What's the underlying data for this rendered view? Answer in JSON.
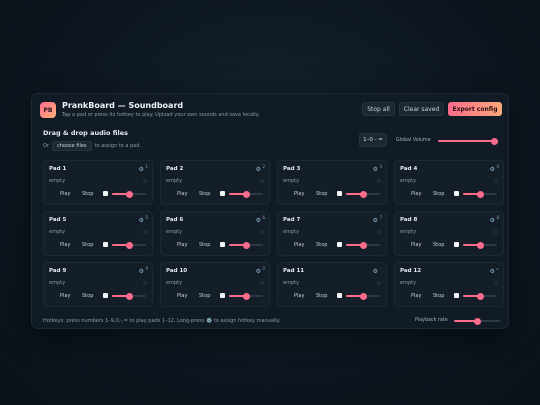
{
  "header": {
    "logo_text": "PB",
    "title": "PrankBoard — Soundboard",
    "subtitle": "Tap a pad or press its hotkey to play. Upload your own sounds and save locally.",
    "stop_all": "Stop all",
    "clear_saved": "Clear saved",
    "export_config": "Export config"
  },
  "drop": {
    "title": "Drag & drop audio files",
    "or": "Or",
    "choose": "choose files",
    "assign": "to assign to a pad."
  },
  "hotkey_range": "1–0 - =",
  "global_volume": {
    "label": "Global Volume",
    "value": 1.0
  },
  "pad_labels": {
    "empty": "empty",
    "play": "Play",
    "stop": "Stop"
  },
  "pads": [
    {
      "name": "Pad 1",
      "key": "1",
      "volume": 0.5
    },
    {
      "name": "Pad 2",
      "key": "2",
      "volume": 0.5
    },
    {
      "name": "Pad 3",
      "key": "3",
      "volume": 0.5
    },
    {
      "name": "Pad 4",
      "key": "4",
      "volume": 0.5
    },
    {
      "name": "Pad 5",
      "key": "5",
      "volume": 0.5
    },
    {
      "name": "Pad 6",
      "key": "6",
      "volume": 0.5
    },
    {
      "name": "Pad 7",
      "key": "7",
      "volume": 0.5
    },
    {
      "name": "Pad 8",
      "key": "8",
      "volume": 0.5
    },
    {
      "name": "Pad 9",
      "key": "9",
      "volume": 0.5
    },
    {
      "name": "Pad 10",
      "key": "0",
      "volume": 0.5
    },
    {
      "name": "Pad 11",
      "key": "-",
      "volume": 0.5
    },
    {
      "name": "Pad 12",
      "key": "=",
      "volume": 0.5
    }
  ],
  "footer": {
    "hotkeys_note": "Hotkeys: press numbers 1–9,0,-,= to play pads 1–12. Long-press ⚙️ to assign hotkey manually.",
    "playback_rate": {
      "label": "Playback rate",
      "value": 0.5
    }
  },
  "colors": {
    "accent": "#ff6b8b",
    "accent2": "#ffa97a",
    "panel": "#111b25"
  }
}
